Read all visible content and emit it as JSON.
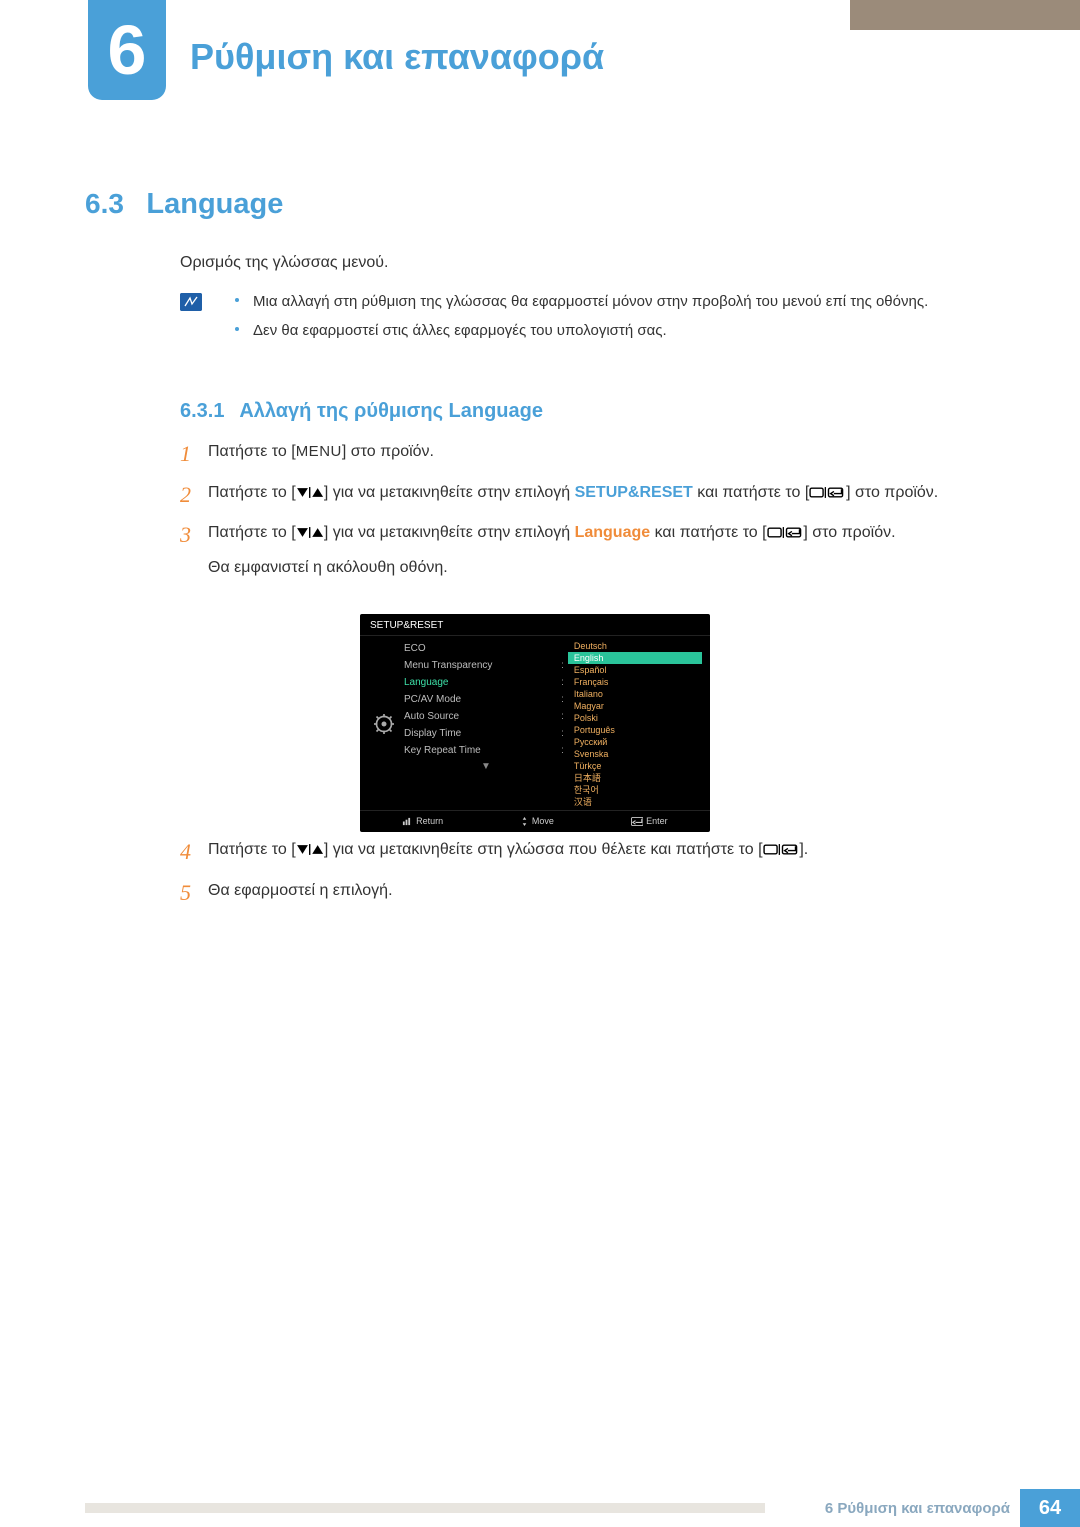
{
  "chapter": {
    "number": "6",
    "title": "Ρύθμιση και επαναφορά"
  },
  "section": {
    "number": "6.3",
    "title": "Language"
  },
  "intro": "Ορισμός της γλώσσας μενού.",
  "notes": [
    "Μια αλλαγή στη ρύθμιση της γλώσσας θα εφαρμοστεί μόνον στην προβολή του μενού επί της οθόνης.",
    "Δεν θα εφαρμοστεί στις άλλες εφαρμογές του υπολογιστή σας."
  ],
  "subsection": {
    "number": "6.3.1",
    "title": "Αλλαγή της ρύθμισης Language"
  },
  "steps": {
    "s1": {
      "num": "1",
      "pre": "Πατήστε το [",
      "menu": "MENU",
      "post": "] στο προϊόν."
    },
    "s2": {
      "num": "2",
      "pre": "Πατήστε το [",
      "mid1": "] για να μετακινηθείτε στην επιλογή ",
      "kw": "SETUP&RESET",
      "mid2": " και πατήστε το [",
      "post": "] στο προϊόν."
    },
    "s3": {
      "num": "3",
      "pre": "Πατήστε το [",
      "mid1": "] για να μετακινηθείτε στην επιλογή ",
      "kw": "Language",
      "mid2": " και πατήστε το [",
      "post": "] στο προϊόν.",
      "sub": "Θα εμφανιστεί η ακόλουθη οθόνη."
    },
    "s4": {
      "num": "4",
      "pre": "Πατήστε το [",
      "mid1": "] για να μετακινηθείτε στη γλώσσα που θέλετε και πατήστε το [",
      "post": "]."
    },
    "s5": {
      "num": "5",
      "text": "Θα εφαρμοστεί η επιλογή."
    }
  },
  "osd": {
    "title": "SETUP&RESET",
    "menu": [
      "ECO",
      "Menu Transparency",
      "Language",
      "PC/AV Mode",
      "Auto Source",
      "Display Time",
      "Key Repeat Time"
    ],
    "active_index": 2,
    "languages": [
      "Deutsch",
      "English",
      "Español",
      "Français",
      "Italiano",
      "Magyar",
      "Polski",
      "Português",
      "Русский",
      "Svenska",
      "Türkçe",
      "日本語",
      "한국어",
      "汉语"
    ],
    "selected_lang_index": 1,
    "footer": {
      "return": "Return",
      "move": "Move",
      "enter": "Enter"
    }
  },
  "footer": {
    "label": "6 Ρύθμιση και επαναφορά",
    "page": "64"
  }
}
